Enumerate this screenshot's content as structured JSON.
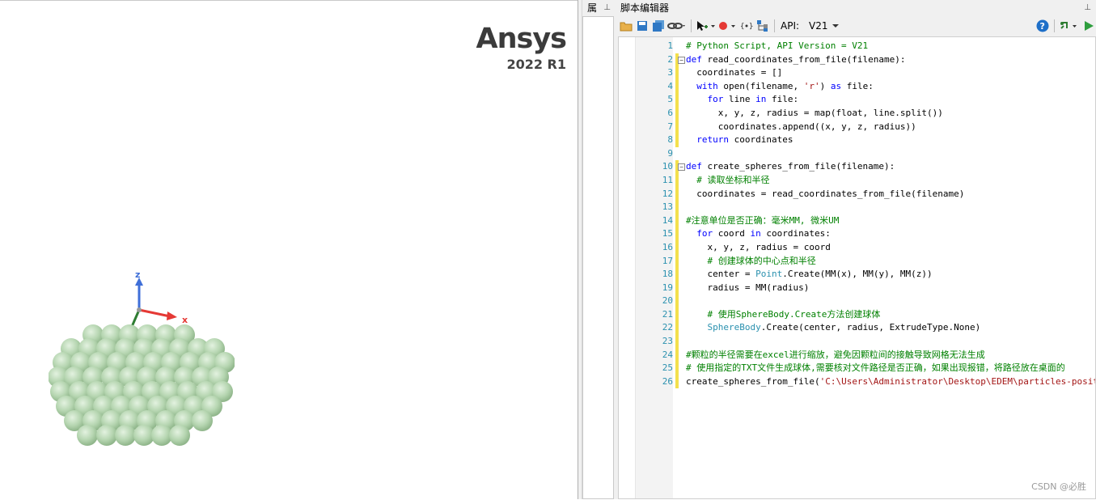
{
  "brand": {
    "name": "Ansys",
    "version": "2022 R1"
  },
  "triad": {
    "x_label": "x",
    "z_label": "z"
  },
  "side_panel": {
    "title": "属"
  },
  "editor": {
    "title": "脚本编辑器",
    "api_label": "API:",
    "api_version": "V21",
    "lines": [
      {
        "n": "1",
        "indent": "",
        "parts": [
          {
            "t": "# Python Script, API Version = V21",
            "c": "cm"
          }
        ]
      },
      {
        "n": "2",
        "indent": "",
        "fold": "−",
        "parts": [
          {
            "t": "def ",
            "c": "kw"
          },
          {
            "t": "read_coordinates_from_file(filename):",
            "c": ""
          }
        ]
      },
      {
        "n": "3",
        "indent": "  ",
        "parts": [
          {
            "t": "coordinates = []",
            "c": ""
          }
        ]
      },
      {
        "n": "4",
        "indent": "  ",
        "parts": [
          {
            "t": "with ",
            "c": "kw"
          },
          {
            "t": "open(filename, ",
            "c": ""
          },
          {
            "t": "'r'",
            "c": "st"
          },
          {
            "t": ") ",
            "c": ""
          },
          {
            "t": "as ",
            "c": "kw"
          },
          {
            "t": "file:",
            "c": ""
          }
        ]
      },
      {
        "n": "5",
        "indent": "    ",
        "parts": [
          {
            "t": "for ",
            "c": "kw"
          },
          {
            "t": "line ",
            "c": ""
          },
          {
            "t": "in ",
            "c": "kw"
          },
          {
            "t": "file:",
            "c": ""
          }
        ]
      },
      {
        "n": "6",
        "indent": "      ",
        "parts": [
          {
            "t": "x, y, z, radius = map(float, line.split())",
            "c": ""
          }
        ]
      },
      {
        "n": "7",
        "indent": "      ",
        "parts": [
          {
            "t": "coordinates.append((x, y, z, radius))",
            "c": ""
          }
        ]
      },
      {
        "n": "8",
        "indent": "  ",
        "parts": [
          {
            "t": "return ",
            "c": "kw"
          },
          {
            "t": "coordinates",
            "c": ""
          }
        ]
      },
      {
        "n": "9",
        "indent": "",
        "parts": []
      },
      {
        "n": "10",
        "indent": "",
        "fold": "−",
        "parts": [
          {
            "t": "def ",
            "c": "kw"
          },
          {
            "t": "create_spheres_from_file(filename):",
            "c": ""
          }
        ]
      },
      {
        "n": "11",
        "indent": "  ",
        "parts": [
          {
            "t": "# 读取坐标和半径",
            "c": "cm"
          }
        ]
      },
      {
        "n": "12",
        "indent": "  ",
        "parts": [
          {
            "t": "coordinates = read_coordinates_from_file(filename)",
            "c": ""
          }
        ]
      },
      {
        "n": "13",
        "indent": "",
        "parts": []
      },
      {
        "n": "14",
        "indent": "",
        "parts": [
          {
            "t": "#注意单位是否正确：毫米MM, 微米UM",
            "c": "cm"
          }
        ]
      },
      {
        "n": "15",
        "indent": "  ",
        "parts": [
          {
            "t": "for ",
            "c": "kw"
          },
          {
            "t": "coord ",
            "c": ""
          },
          {
            "t": "in ",
            "c": "kw"
          },
          {
            "t": "coordinates:",
            "c": ""
          }
        ]
      },
      {
        "n": "16",
        "indent": "    ",
        "parts": [
          {
            "t": "x, y, z, radius = coord",
            "c": ""
          }
        ]
      },
      {
        "n": "17",
        "indent": "    ",
        "parts": [
          {
            "t": "# 创建球体的中心点和半径",
            "c": "cm"
          }
        ]
      },
      {
        "n": "18",
        "indent": "    ",
        "parts": [
          {
            "t": "center = ",
            "c": ""
          },
          {
            "t": "Point",
            "c": "cls"
          },
          {
            "t": ".Create(MM(x), MM(y), MM(z))",
            "c": ""
          }
        ]
      },
      {
        "n": "19",
        "indent": "    ",
        "parts": [
          {
            "t": "radius = MM(radius)",
            "c": ""
          }
        ]
      },
      {
        "n": "20",
        "indent": "",
        "parts": []
      },
      {
        "n": "21",
        "indent": "    ",
        "parts": [
          {
            "t": "# 使用SphereBody.Create方法创建球体",
            "c": "cm"
          }
        ]
      },
      {
        "n": "22",
        "indent": "    ",
        "parts": [
          {
            "t": "SphereBody",
            "c": "cls"
          },
          {
            "t": ".Create(center, radius, ExtrudeType.None)",
            "c": ""
          }
        ]
      },
      {
        "n": "23",
        "indent": "",
        "parts": []
      },
      {
        "n": "24",
        "indent": "",
        "parts": [
          {
            "t": "#颗粒的半径需要在excel进行缩放，避免因颗粒间的接触导致网格无法生成",
            "c": "cm"
          }
        ]
      },
      {
        "n": "25",
        "indent": "",
        "parts": [
          {
            "t": "# 使用指定的TXT文件生成球体,需要核对文件路径是否正确，如果出现报错，将路径放在桌面的",
            "c": "cm"
          }
        ]
      },
      {
        "n": "26",
        "indent": "",
        "parts": [
          {
            "t": "create_spheres_from_file(",
            "c": ""
          },
          {
            "t": "'C:\\Users\\Administrator\\Desktop\\EDEM\\particles-posit",
            "c": "st"
          }
        ]
      }
    ]
  },
  "watermark": "CSDN @必胜",
  "colors": {
    "sphere": "#b8d8b4",
    "x_axis": "#e53935",
    "z_axis": "#3f6fd8",
    "y_axis": "#2e7d32"
  }
}
